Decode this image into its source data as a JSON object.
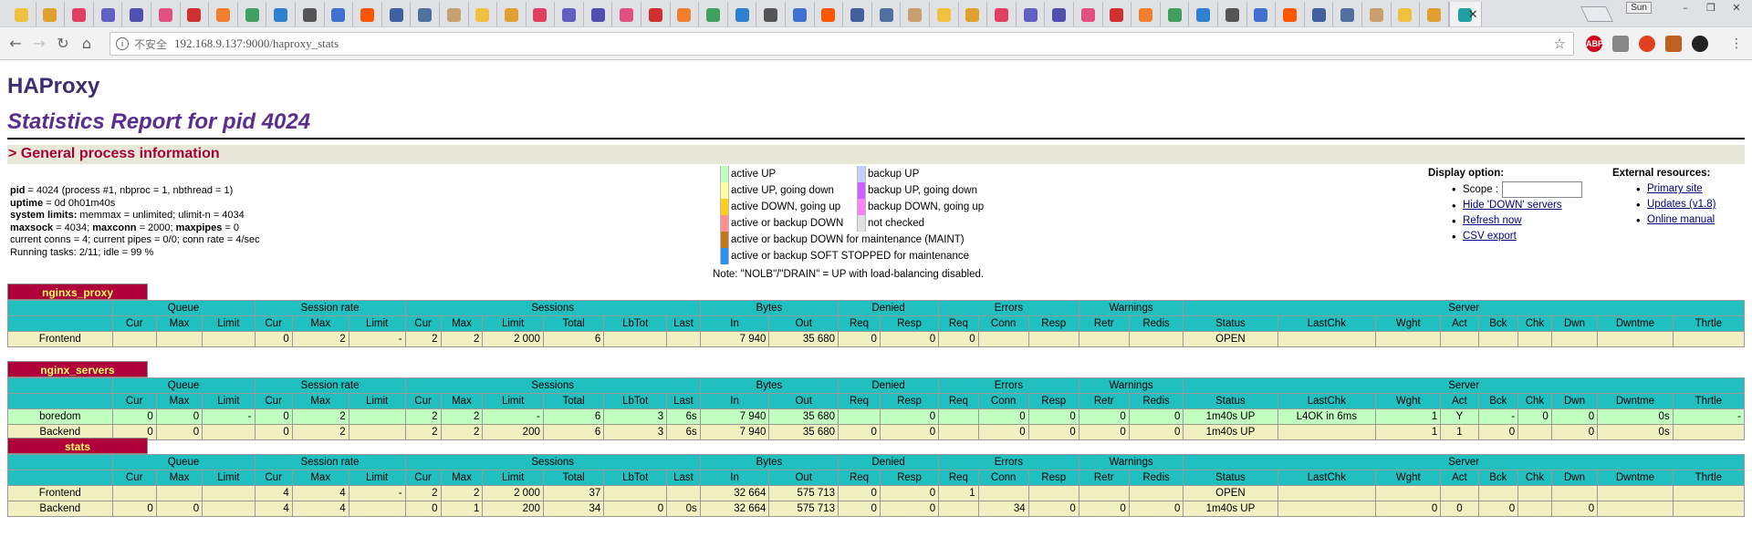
{
  "browser": {
    "tab_icons": [
      "note-icon",
      "dj-icon",
      "flower-icon",
      "e-icon",
      "n-icon",
      "heart-icon",
      "red-dot-icon",
      "a-icon",
      "image-icon",
      "doc-icon",
      "hash-icon",
      "image-icon",
      "reddit-icon",
      "gear-icon",
      "v-icon",
      "face-icon",
      "face-icon",
      "face-icon",
      "face-icon",
      "face-icon",
      "face-icon",
      "face-icon",
      "face-icon",
      "page-icon",
      "page-icon",
      "bird-icon",
      "game-icon",
      "page-icon",
      "page-icon",
      "firefox-icon",
      "y-icon",
      "linkedin-icon",
      "s-icon",
      "bank-icon",
      "pen-icon",
      "b-icon",
      "b-icon",
      "pen-icon",
      "face-icon",
      "face-icon",
      "face-icon",
      "x-icon",
      "paw-icon",
      "hand-icon",
      "doc-icon",
      "doc-icon",
      "cloud-icon",
      "c-icon",
      "x-icon",
      "s-icon"
    ],
    "user_badge": "Sun",
    "url_insecure": "不安全",
    "url": "192.168.9.137:9000/haproxy_stats"
  },
  "page": {
    "title": "HAProxy",
    "report_title": "Statistics Report for pid 4024",
    "section_title": "> General process information"
  },
  "procinfo": {
    "pid_label": "pid",
    "pid_value": " = 4024 (process #1, nbproc = 1, nbthread = 1)",
    "uptime_label": "uptime",
    "uptime_value": " = 0d 0h01m40s",
    "limits_label": "system limits:",
    "limits_value": " memmax = unlimited; ulimit-n = 4034",
    "maxsock_label": "maxsock",
    "maxsock_value": " = 4034; ",
    "maxconn_label": "maxconn",
    "maxconn_value": " = 2000; ",
    "maxpipes_label": "maxpipes",
    "maxpipes_value": " = 0",
    "conns": "current conns = 4; current pipes = 0/0; conn rate = 4/sec",
    "tasks": "Running tasks: 2/11; idle = 99 %"
  },
  "legend": {
    "left": [
      {
        "label": "active UP",
        "color": "#c0ffc0"
      },
      {
        "label": "active UP, going down",
        "color": "#ffffa0"
      },
      {
        "label": "active DOWN, going up",
        "color": "#ffd020"
      },
      {
        "label": "active or backup DOWN",
        "color": "#ff9090"
      },
      {
        "label": "active or backup DOWN for maintenance (MAINT)",
        "color": "#c07820"
      },
      {
        "label": "active or backup SOFT STOPPED for maintenance",
        "color": "#3090f0"
      }
    ],
    "right": [
      {
        "label": "backup UP",
        "color": "#c0d0ff"
      },
      {
        "label": "backup UP, going down",
        "color": "#d060ff"
      },
      {
        "label": "backup DOWN, going up",
        "color": "#ff80ff"
      },
      {
        "label": "not checked",
        "color": "#e0e0e0"
      }
    ],
    "note": "Note: \"NOLB\"/\"DRAIN\" = UP with load-balancing disabled."
  },
  "display": {
    "title": "Display option:",
    "scope_label": "Scope :",
    "scope_value": "",
    "links": [
      "Hide 'DOWN' servers",
      "Refresh now",
      "CSV export"
    ]
  },
  "external": {
    "title": "External resources:",
    "links": [
      "Primary site",
      "Updates (v1.8)",
      "Online manual"
    ]
  },
  "headers": {
    "groups": [
      "Queue",
      "Session rate",
      "Sessions",
      "Bytes",
      "Denied",
      "Errors",
      "Warnings",
      "Server"
    ],
    "cols": [
      "Cur",
      "Max",
      "Limit",
      "Cur",
      "Max",
      "Limit",
      "Cur",
      "Max",
      "Limit",
      "Total",
      "LbTot",
      "Last",
      "In",
      "Out",
      "Req",
      "Resp",
      "Req",
      "Conn",
      "Resp",
      "Retr",
      "Redis",
      "Status",
      "LastChk",
      "Wght",
      "Act",
      "Bck",
      "Chk",
      "Dwn",
      "Dwntme",
      "Thrtle"
    ]
  },
  "proxies": [
    {
      "name": "nginxs_proxy",
      "rows": [
        {
          "kind": "fe",
          "name": "Frontend",
          "cells": [
            "",
            "",
            "",
            "0",
            "2",
            "-",
            "2",
            "2",
            "2 000",
            "6",
            "",
            "",
            "7 940",
            "35 680",
            "0",
            "0",
            "0",
            "",
            "",
            "",
            "",
            "OPEN",
            "",
            "",
            "",
            "",
            "",
            "",
            "",
            ""
          ]
        }
      ]
    },
    {
      "name": "nginx_servers",
      "rows": [
        {
          "kind": "up",
          "name": "boredom",
          "cells": [
            "0",
            "0",
            "-",
            "0",
            "2",
            "",
            "2",
            "2",
            "-",
            "6",
            "3",
            "6s",
            "7 940",
            "35 680",
            "",
            "0",
            "",
            "0",
            "0",
            "0",
            "0",
            "1m40s UP",
            "L4OK in 6ms",
            "1",
            "Y",
            "-",
            "0",
            "0",
            "0s",
            "-"
          ]
        },
        {
          "kind": "be",
          "name": "Backend",
          "cells": [
            "0",
            "0",
            "",
            "0",
            "2",
            "",
            "2",
            "2",
            "200",
            "6",
            "3",
            "6s",
            "7 940",
            "35 680",
            "0",
            "0",
            "",
            "0",
            "0",
            "0",
            "0",
            "1m40s UP",
            "",
            "1",
            "1",
            "0",
            "",
            "0",
            "0s",
            ""
          ]
        }
      ]
    },
    {
      "name": "stats",
      "rows": [
        {
          "kind": "fe",
          "name": "Frontend",
          "cells": [
            "",
            "",
            "",
            "4",
            "4",
            "-",
            "2",
            "2",
            "2 000",
            "37",
            "",
            "",
            "32 664",
            "575 713",
            "0",
            "0",
            "1",
            "",
            "",
            "",
            "",
            "OPEN",
            "",
            "",
            "",
            "",
            "",
            "",
            "",
            ""
          ]
        },
        {
          "kind": "be",
          "name": "Backend",
          "cells": [
            "0",
            "0",
            "",
            "4",
            "4",
            "",
            "0",
            "1",
            "200",
            "34",
            "0",
            "0s",
            "32 664",
            "575 713",
            "0",
            "0",
            "",
            "34",
            "0",
            "0",
            "0",
            "1m40s UP",
            "",
            "0",
            "0",
            "0",
            "",
            "0",
            "",
            ""
          ]
        }
      ]
    }
  ]
}
